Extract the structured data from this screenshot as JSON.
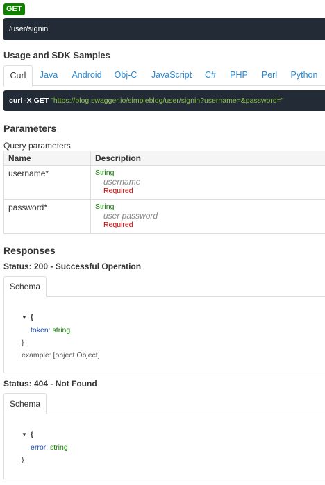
{
  "method": "GET",
  "path": "/user/signin",
  "usage": {
    "title": "Usage and SDK Samples",
    "tabs": [
      "Curl",
      "Java",
      "Android",
      "Obj-C",
      "JavaScript",
      "C#",
      "PHP",
      "Perl",
      "Python"
    ],
    "active_tab": "Curl",
    "curl_cmd": "curl -X GET",
    "curl_url": "\"https://blog.swagger.io/simpleblog/user/signin?username=&password=\""
  },
  "parameters": {
    "title": "Parameters",
    "subtitle": "Query parameters",
    "headers": [
      "Name",
      "Description"
    ],
    "rows": [
      {
        "name": "username*",
        "type": "String",
        "desc": "username",
        "required": "Required"
      },
      {
        "name": "password*",
        "type": "String",
        "desc": "user password",
        "required": "Required"
      }
    ]
  },
  "responses": {
    "title": "Responses",
    "items": [
      {
        "status": "Status: 200 - Successful Operation",
        "tab": "Schema",
        "open": "{",
        "key": "token:",
        "value": "string",
        "close": "}",
        "example": "example: [object Object]"
      },
      {
        "status": "Status: 404 - Not Found",
        "tab": "Schema",
        "open": "{",
        "key": "error:",
        "value": "string",
        "close": "}"
      }
    ]
  },
  "colors": {
    "get_badge": "#108200",
    "dark_bar": "#232b36",
    "link": "#2a8ad4",
    "type_green": "#108200",
    "required_red": "#d00000"
  }
}
